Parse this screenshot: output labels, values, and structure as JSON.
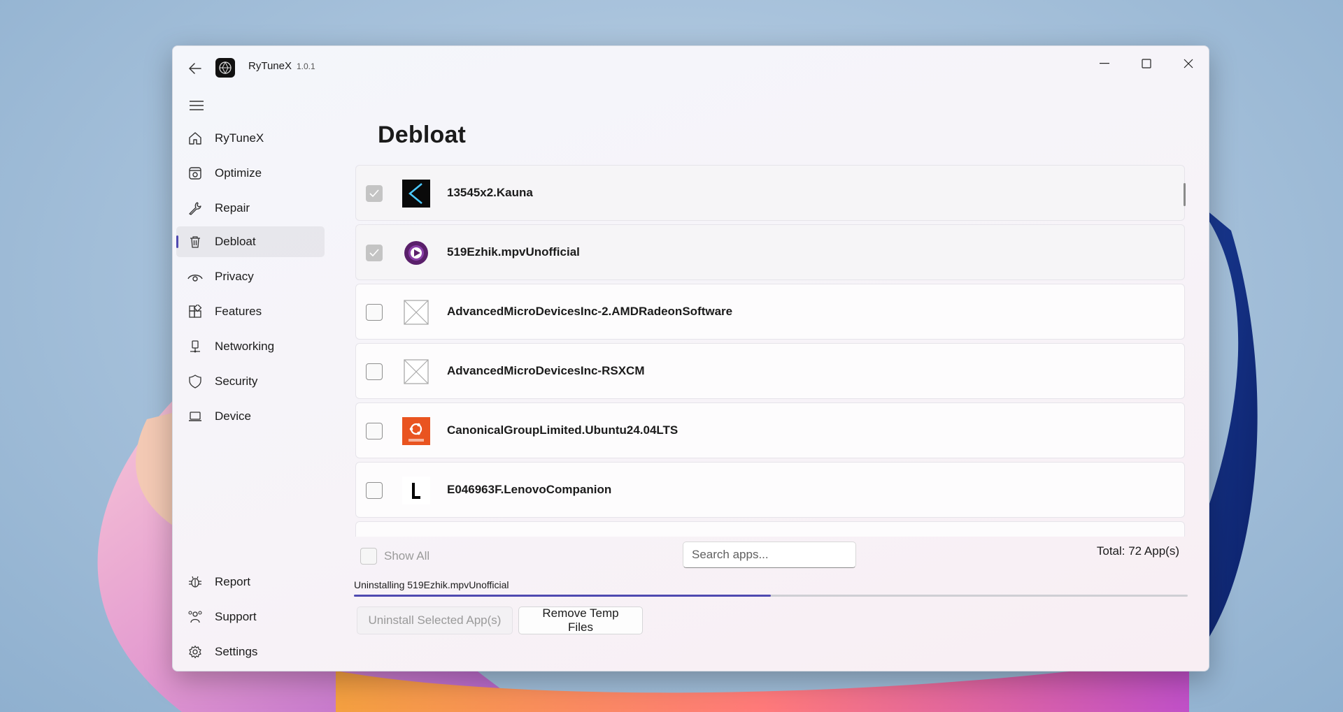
{
  "window": {
    "title": "RyTuneX",
    "version": "1.0.1"
  },
  "sidebar": {
    "items": [
      {
        "label": "RyTuneX",
        "icon": "home-icon"
      },
      {
        "label": "Optimize",
        "icon": "optimize-icon"
      },
      {
        "label": "Repair",
        "icon": "wrench-icon"
      },
      {
        "label": "Debloat",
        "icon": "trash-icon",
        "active": true
      },
      {
        "label": "Privacy",
        "icon": "eye-icon"
      },
      {
        "label": "Features",
        "icon": "features-icon"
      },
      {
        "label": "Networking",
        "icon": "network-icon"
      },
      {
        "label": "Security",
        "icon": "shield-icon"
      },
      {
        "label": "Device",
        "icon": "laptop-icon"
      }
    ],
    "footer_items": [
      {
        "label": "Report",
        "icon": "bug-icon"
      },
      {
        "label": "Support",
        "icon": "support-icon"
      },
      {
        "label": "Settings",
        "icon": "gear-icon"
      }
    ]
  },
  "page": {
    "title": "Debloat"
  },
  "apps": [
    {
      "name": "13545x2.Kauna",
      "checked": true,
      "icon": "kauna-icon"
    },
    {
      "name": "519Ezhik.mpvUnofficial",
      "checked": true,
      "icon": "mpv-icon"
    },
    {
      "name": "AdvancedMicroDevicesInc-2.AMDRadeonSoftware",
      "checked": false,
      "icon": "placeholder-icon"
    },
    {
      "name": "AdvancedMicroDevicesInc-RSXCM",
      "checked": false,
      "icon": "placeholder-icon"
    },
    {
      "name": "CanonicalGroupLimited.Ubuntu24.04LTS",
      "checked": false,
      "icon": "ubuntu-icon"
    },
    {
      "name": "E046963F.LenovoCompanion",
      "checked": false,
      "icon": "lenovo-icon"
    }
  ],
  "controls": {
    "show_all_label": "Show All",
    "search_placeholder": "Search apps...",
    "total_label": "Total: 72 App(s)",
    "status_text": "Uninstalling 519Ezhik.mpvUnofficial",
    "progress": 0.5,
    "uninstall_label": "Uninstall Selected App(s)",
    "temp_label": "Remove Temp Files"
  },
  "colors": {
    "accent": "#4f4ab0",
    "ubuntu": "#e95420",
    "mpv": "#5a1f6b"
  }
}
